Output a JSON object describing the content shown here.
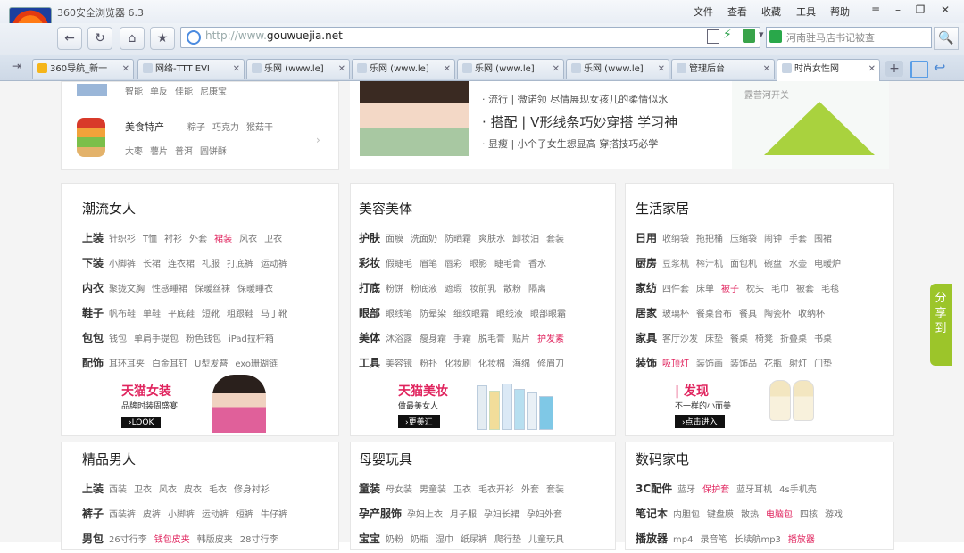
{
  "window": {
    "title": "360安全浏览器 6.3",
    "menus": [
      "文件",
      "查看",
      "收藏",
      "工具",
      "帮助"
    ],
    "controls": [
      "≡",
      "–",
      "❐",
      "✕"
    ]
  },
  "toolbar": {
    "back": "←",
    "reload": "↻",
    "home": "⌂",
    "favorite": "★",
    "url_prefix": "http://www.",
    "url_domain": "gouwuejia.net",
    "search_placeholder": "河南驻马店书记被查",
    "search_symbol": "🔍"
  },
  "tabs": [
    {
      "label": "360导航_新一",
      "active": false
    },
    {
      "label": "网络-TTT EVI",
      "active": false
    },
    {
      "label": "乐网 (www.le]",
      "active": false
    },
    {
      "label": "乐网 (www.le]",
      "active": false
    },
    {
      "label": "乐网 (www.le]",
      "active": false
    },
    {
      "label": "乐网 (www.le]",
      "active": false
    },
    {
      "label": "管理后台",
      "active": false
    },
    {
      "label": "时尚女性网",
      "active": true
    }
  ],
  "top_section": {
    "row1_items": [
      "智能",
      "单反",
      "佳能",
      "尼康宝"
    ],
    "row2_cat": "美食特产",
    "row2_items": [
      "粽子",
      "巧克力",
      "猴菇干"
    ],
    "row3_items": [
      "大枣",
      "薯片",
      "普洱",
      "圆饼酥"
    ],
    "articles": [
      "· 流行 | 微诺领  尽情展现女孩儿的柔情似水",
      "· 搭配 | V形线条巧妙穿搭 学习神",
      "· 显瘦 | 小个子女生想显高 穿搭技巧必学"
    ],
    "side_caption": "露营河开关"
  },
  "sections": [
    {
      "title": "潮流女人",
      "rows": [
        {
          "cat": "上装",
          "items": [
            "针织衫",
            "T恤",
            "衬衫",
            "外套",
            "裙装",
            "风衣",
            "卫衣"
          ],
          "hot": [
            4
          ]
        },
        {
          "cat": "下装",
          "items": [
            "小脚裤",
            "长裙",
            "连衣裙",
            "礼服",
            "打底裤",
            "运动裤"
          ],
          "hot": []
        },
        {
          "cat": "内衣",
          "items": [
            "聚拢文胸",
            "性感睡裙",
            "保暖丝袜",
            "保暖睡衣"
          ],
          "hot": []
        },
        {
          "cat": "鞋子",
          "items": [
            "帆布鞋",
            "单鞋",
            "平底鞋",
            "短靴",
            "粗跟鞋",
            "马丁靴"
          ],
          "hot": []
        },
        {
          "cat": "包包",
          "items": [
            "钱包",
            "单肩手提包",
            "粉色钱包",
            "iPad拉杆箱"
          ],
          "hot": []
        },
        {
          "cat": "配饰",
          "items": [
            "耳环耳夹",
            "白金耳钉",
            "U型发簪",
            "exo珊瑚链"
          ],
          "hot": []
        }
      ],
      "promo": {
        "brand": "天猫女装",
        "sub": "品牌时装周盛宴",
        "btn": "›LOOK"
      }
    },
    {
      "title": "美容美体",
      "rows": [
        {
          "cat": "护肤",
          "items": [
            "面膜",
            "洗面奶",
            "防晒霜",
            "爽肤水",
            "卸妆油",
            "套装"
          ],
          "hot": []
        },
        {
          "cat": "彩妆",
          "items": [
            "假睫毛",
            "眉笔",
            "唇彩",
            "眼影",
            "睫毛膏",
            "香水"
          ],
          "hot": []
        },
        {
          "cat": "打底",
          "items": [
            "粉饼",
            "粉底液",
            "遮瑕",
            "妆前乳",
            "散粉",
            "隔离"
          ],
          "hot": []
        },
        {
          "cat": "眼部",
          "items": [
            "眼线笔",
            "防晕染",
            "细纹眼霜",
            "眼线液",
            "眼部眼霜"
          ],
          "hot": []
        },
        {
          "cat": "美体",
          "items": [
            "沐浴露",
            "瘦身霜",
            "手霜",
            "脱毛膏",
            "贴片",
            "护发素"
          ],
          "hot": [
            5
          ]
        },
        {
          "cat": "工具",
          "items": [
            "美容镜",
            "粉扑",
            "化妆刷",
            "化妆棉",
            "海绵",
            "修眉刀"
          ],
          "hot": []
        }
      ],
      "promo": {
        "brand": "天猫美妆",
        "sub": "做最美女人",
        "btn": "›更美汇"
      }
    },
    {
      "title": "生活家居",
      "rows": [
        {
          "cat": "日用",
          "items": [
            "收纳袋",
            "拖把桶",
            "压缩袋",
            "闹钟",
            "手套",
            "围裙"
          ],
          "hot": []
        },
        {
          "cat": "厨房",
          "items": [
            "豆浆机",
            "榨汁机",
            "面包机",
            "碗盘",
            "水壶",
            "电暖炉"
          ],
          "hot": []
        },
        {
          "cat": "家纺",
          "items": [
            "四件套",
            "床单",
            "被子",
            "枕头",
            "毛巾",
            "被套",
            "毛毯"
          ],
          "hot": [
            2
          ]
        },
        {
          "cat": "居家",
          "items": [
            "玻璃杯",
            "餐桌台布",
            "餐具",
            "陶瓷杯",
            "收纳杯"
          ],
          "hot": []
        },
        {
          "cat": "家具",
          "items": [
            "客厅沙发",
            "床垫",
            "餐桌",
            "椅凳",
            "折叠桌",
            "书桌"
          ],
          "hot": []
        },
        {
          "cat": "装饰",
          "items": [
            "吸顶灯",
            "装饰画",
            "装饰品",
            "花瓶",
            "射灯",
            "门垫"
          ],
          "hot": [
            0
          ]
        }
      ],
      "promo": {
        "brand": "| 发现",
        "sub": "不一样的小而美",
        "btn": "›点击进入"
      }
    }
  ],
  "bottom_sections": [
    {
      "title": "精品男人",
      "rows": [
        {
          "cat": "上装",
          "items": [
            "西装",
            "卫衣",
            "风衣",
            "皮衣",
            "毛衣",
            "修身衬衫"
          ],
          "hot": []
        },
        {
          "cat": "裤子",
          "items": [
            "西装裤",
            "皮裤",
            "小脚裤",
            "运动裤",
            "短裤",
            "牛仔裤"
          ],
          "hot": []
        },
        {
          "cat": "男包",
          "items": [
            "26寸行李",
            "钱包皮夹",
            "韩版皮夹",
            "28寸行李"
          ],
          "hot": [
            1
          ]
        }
      ]
    },
    {
      "title": "母婴玩具",
      "rows": [
        {
          "cat": "童装",
          "items": [
            "母女装",
            "男童装",
            "卫衣",
            "毛衣开衫",
            "外套",
            "套装"
          ],
          "hot": []
        },
        {
          "cat": "孕产服饰",
          "items": [
            "孕妇上衣",
            "月子服",
            "孕妇长裙",
            "孕妇外套"
          ],
          "hot": []
        },
        {
          "cat": "宝宝",
          "items": [
            "奶粉",
            "奶瓶",
            "湿巾",
            "纸尿裤",
            "爬行垫",
            "儿童玩具"
          ],
          "hot": []
        }
      ]
    },
    {
      "title": "数码家电",
      "rows": [
        {
          "cat": "3C配件",
          "items": [
            "蓝牙",
            "保护套",
            "蓝牙耳机",
            "4s手机壳"
          ],
          "hot": [
            1
          ]
        },
        {
          "cat": "笔记本",
          "items": [
            "内胆包",
            "键盘膜",
            "散热",
            "电脑包",
            "四核",
            "游戏"
          ],
          "hot": [
            3
          ]
        },
        {
          "cat": "播放器",
          "items": [
            "mp4",
            "录音笔",
            "长续航mp3",
            "播放器"
          ],
          "hot": [
            3
          ]
        }
      ]
    }
  ],
  "share_widget": "分享到",
  "colors": {
    "hot": "#e0245e",
    "share": "#9cc52a",
    "address_border": "#9fb1c8"
  }
}
